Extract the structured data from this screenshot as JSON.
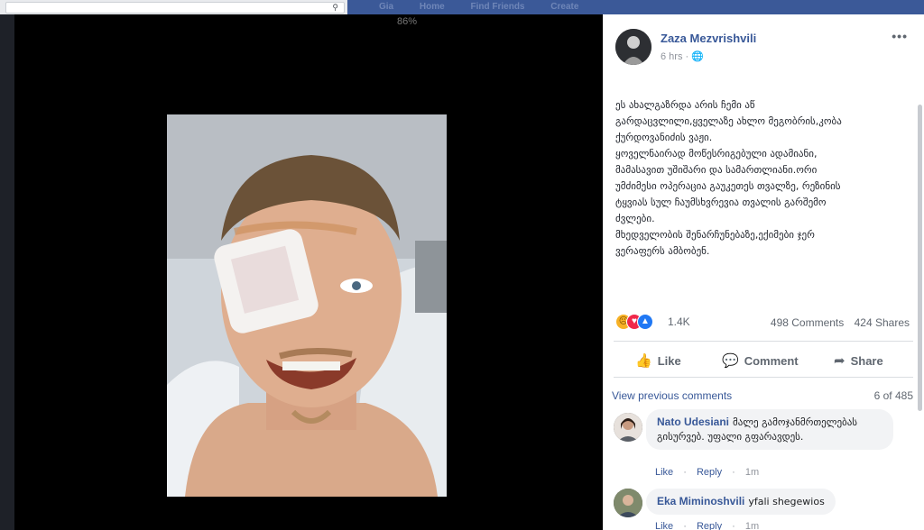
{
  "topbar": {
    "search_icon": "search-icon",
    "nav": [
      "Gia",
      "Home",
      "Find Friends",
      "Create"
    ]
  },
  "photo": {
    "battery": "86%"
  },
  "post": {
    "author": "Zaza Mezvrishvili",
    "time": "6 hrs",
    "privacy_icon": "globe-icon",
    "more": "•••",
    "text_lines": [
      "ეს ახალგაზრდა არის ჩემი აწ",
      "გარდაცვლილი,ყველაზე ახლო მეგობრის,კობა",
      "ქურდოვანიძის ვაჟი.",
      "ყოველნაირად მოწესრიგებული ადამიანი,",
      "მამასავით უშიშარი და სამართლიანი.ორი",
      "უმძიმესი ოპერაცია გაუკეთეს თვალზე, რეზინის",
      "ტყვიას სულ ჩაუმსხვრევია თვალის გარშემო",
      "ძვლები.",
      "მხედველობის შენარჩუნებაზე,ექიმები ჯერ",
      "ვერაფერს ამბობენ."
    ],
    "reactions_count": "1.4K",
    "comments_count": "498 Comments",
    "shares_count": "424 Shares",
    "actions": {
      "like": "Like",
      "comment": "Comment",
      "share": "Share"
    }
  },
  "comments": {
    "view_previous": "View previous comments",
    "pager": "6 of 485",
    "items": [
      {
        "name": "Nato Udesiani",
        "text_line1": "მალე გამოჯანმრთელებას",
        "text_line2": "გისურვებ. უფალი გფარავდეს.",
        "like": "Like",
        "reply": "Reply",
        "time": "1m"
      },
      {
        "name": "Eka Miminoshvili",
        "text": "yfali shegewios",
        "like": "Like",
        "reply": "Reply",
        "time": "1m"
      }
    ]
  }
}
